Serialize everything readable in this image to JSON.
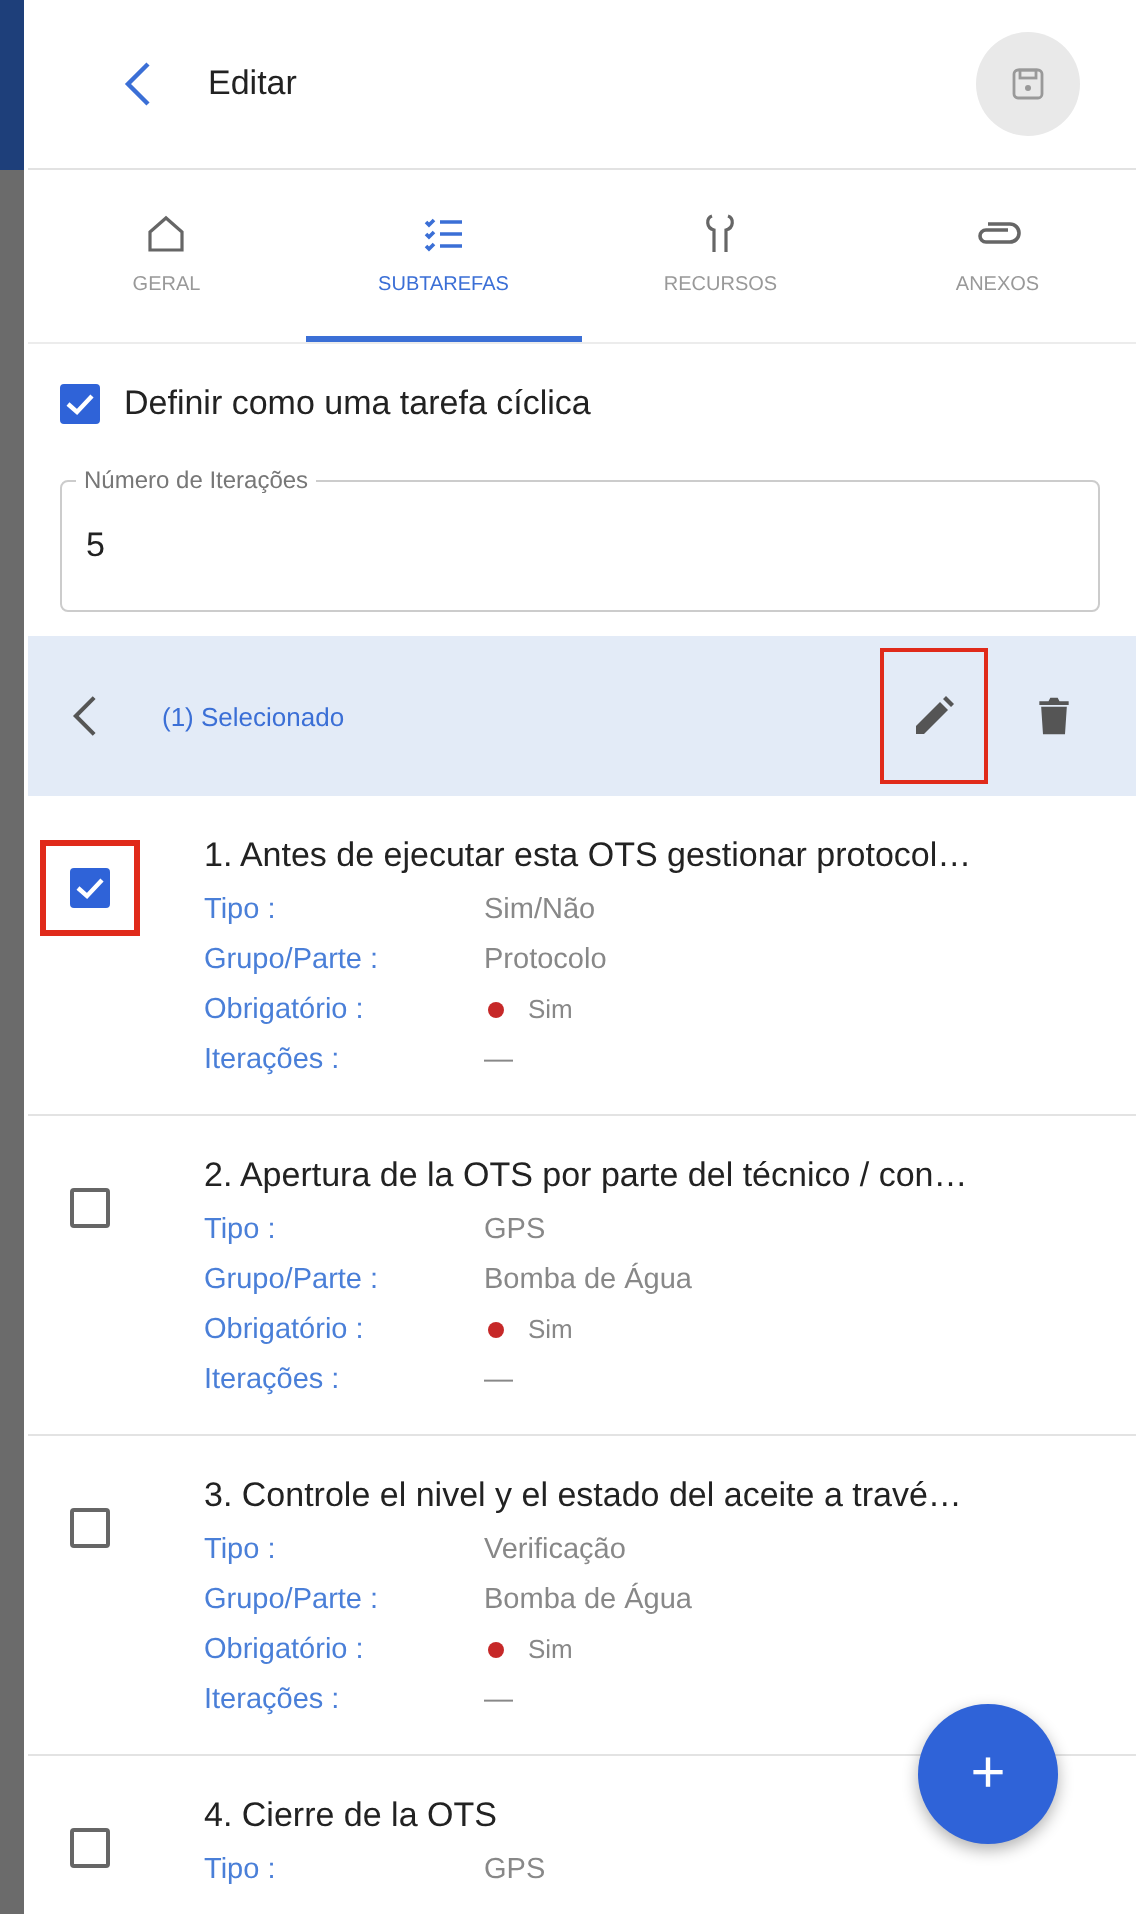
{
  "header": {
    "title": "Editar"
  },
  "tabs": [
    {
      "label": "GERAL",
      "selected": false
    },
    {
      "label": "SUBTAREFAS",
      "selected": true
    },
    {
      "label": "RECURSOS",
      "selected": false
    },
    {
      "label": "ANEXOS",
      "selected": false
    }
  ],
  "cyclic": {
    "label": "Definir como uma tarefa cíclica",
    "checked": true
  },
  "iterations_field": {
    "label": "Número de Iterações",
    "value": "5"
  },
  "selection_bar": {
    "label": "(1) Selecionado",
    "edit_highlighted": true
  },
  "subtasks": [
    {
      "title": "1. Antes de ejecutar esta OTS gestionar protocol…",
      "checked": true,
      "highlighted": true,
      "fields": [
        {
          "label": "Tipo :",
          "value": "Sim/Não",
          "kind": "text"
        },
        {
          "label": "Grupo/Parte :",
          "value": "Protocolo",
          "kind": "text"
        },
        {
          "label": "Obrigatório :",
          "value": "Sim",
          "kind": "status"
        },
        {
          "label": "Iterações :",
          "value": "—",
          "kind": "text"
        }
      ]
    },
    {
      "title": "2. Apertura de la OTS por parte del técnico / con…",
      "checked": false,
      "highlighted": false,
      "fields": [
        {
          "label": "Tipo :",
          "value": "GPS",
          "kind": "text"
        },
        {
          "label": "Grupo/Parte :",
          "value": "Bomba de Água",
          "kind": "text"
        },
        {
          "label": "Obrigatório :",
          "value": "Sim",
          "kind": "status"
        },
        {
          "label": "Iterações :",
          "value": "—",
          "kind": "text"
        }
      ]
    },
    {
      "title": "3. Controle el nivel y el estado del aceite a travé…",
      "checked": false,
      "highlighted": false,
      "fields": [
        {
          "label": "Tipo :",
          "value": "Verificação",
          "kind": "text"
        },
        {
          "label": "Grupo/Parte :",
          "value": "Bomba de Água",
          "kind": "text"
        },
        {
          "label": "Obrigatório :",
          "value": "Sim",
          "kind": "status"
        },
        {
          "label": "Iterações :",
          "value": "—",
          "kind": "text"
        }
      ]
    },
    {
      "title": "4. Cierre de la OTS",
      "checked": false,
      "highlighted": false,
      "fields": [
        {
          "label": "Tipo :",
          "value": "GPS",
          "kind": "text"
        }
      ]
    }
  ],
  "fab": {
    "label": "+"
  }
}
